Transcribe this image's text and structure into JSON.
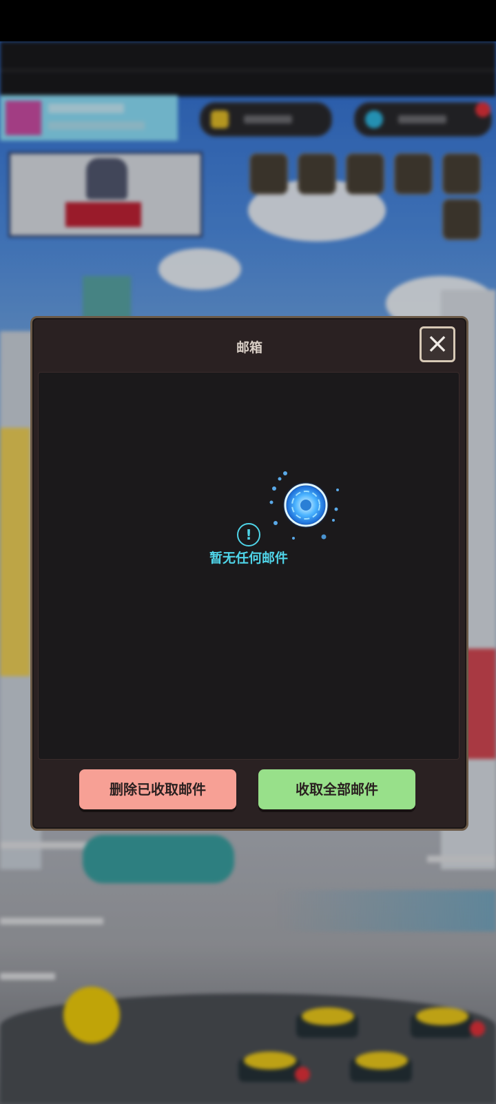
{
  "dialog": {
    "title": "邮箱",
    "close_icon": "×",
    "empty_icon": "!",
    "empty_message": "暂无任何邮件",
    "delete_button_label": "删除已收取邮件",
    "collect_button_label": "收取全部邮件"
  },
  "colors": {
    "delete_button": "#f7a095",
    "collect_button": "#98e08a",
    "empty_text": "#4fd4e8",
    "dialog_bg": "#2a2122"
  }
}
